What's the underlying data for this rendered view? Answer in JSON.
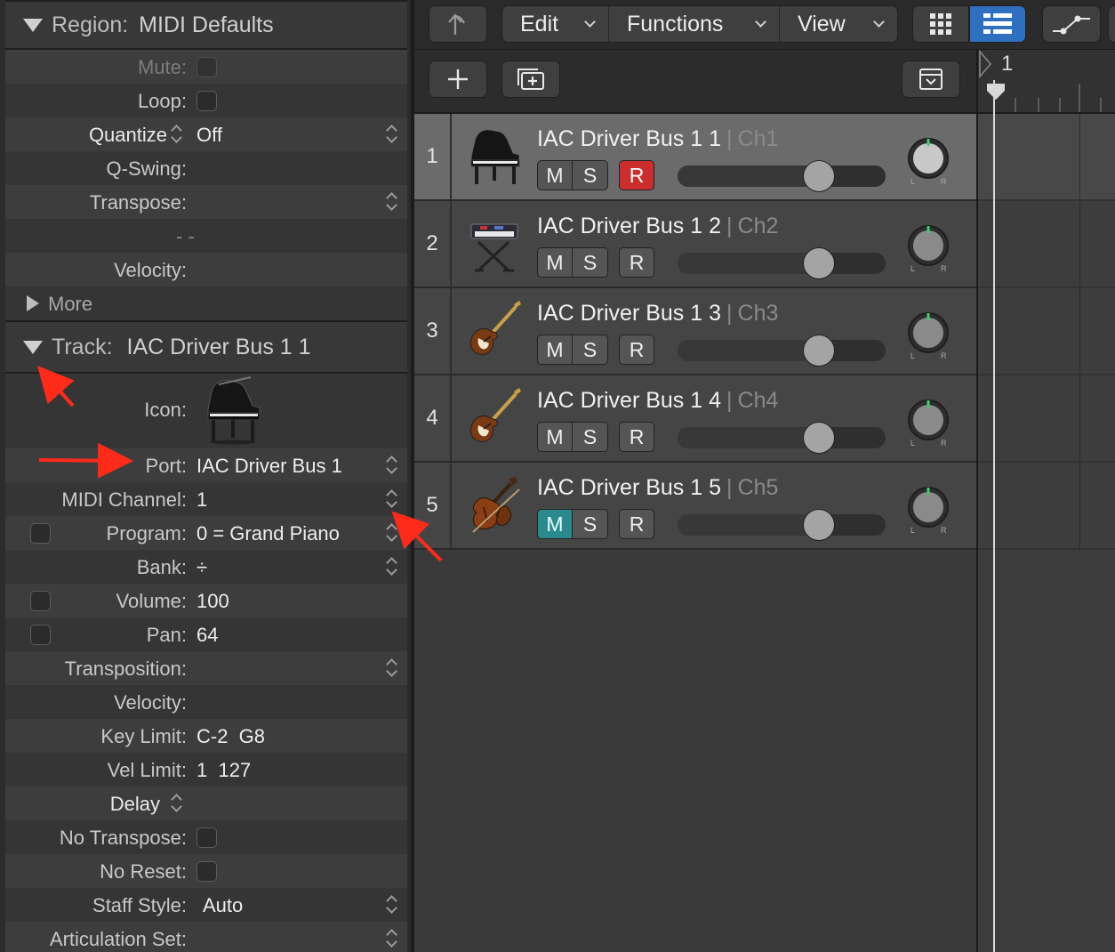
{
  "region": {
    "label": "Region:",
    "value": "MIDI Defaults",
    "rows": [
      {
        "key": "Mute:",
        "type": "checkbox"
      },
      {
        "key": "Loop:",
        "type": "checkbox"
      },
      {
        "key": "Quantize",
        "value": "Off"
      },
      {
        "key": "Q-Swing:",
        "value": ""
      },
      {
        "key": "Transpose:",
        "value": ""
      },
      {
        "key": "",
        "value": "- -"
      },
      {
        "key": "Velocity:",
        "value": ""
      }
    ],
    "more": "More"
  },
  "track_inspector": {
    "label": "Track:",
    "value": "IAC Driver Bus 1 1",
    "icon_label": "Icon:",
    "icon": "grand-piano-icon",
    "rows": [
      {
        "key": "Port:",
        "value": "IAC Driver Bus 1"
      },
      {
        "key": "MIDI Channel:",
        "value": "1"
      },
      {
        "key": "Program:",
        "value": "0 = Grand Piano"
      },
      {
        "key": "Bank:",
        "value": "÷"
      },
      {
        "key": "Volume:",
        "value": "100"
      },
      {
        "key": "Pan:",
        "value": "64"
      },
      {
        "key": "Transposition:",
        "value": ""
      },
      {
        "key": "Velocity:",
        "value": ""
      },
      {
        "key": "Key Limit:",
        "value": "C-2  G8"
      },
      {
        "key": "Vel Limit:",
        "value": "1  127"
      },
      {
        "key": "Delay",
        "value": ""
      },
      {
        "key": "No Transpose:",
        "value": ""
      },
      {
        "key": "No Reset:",
        "value": ""
      },
      {
        "key": "Staff Style:",
        "value": "Auto"
      },
      {
        "key": "Articulation Set:",
        "value": ""
      }
    ]
  },
  "toolbar": {
    "back_icon": "back-arrow-icon",
    "menus": [
      "Edit",
      "Functions",
      "View"
    ],
    "grid_view_icon": "grid-view-icon",
    "list_view_icon": "list-view-icon",
    "automation_icon": "automation-curve-icon"
  },
  "subbar": {
    "add_icon": "plus-icon",
    "duplicate_icon": "duplicate-track-icon",
    "collapse_icon": "collapse-icon"
  },
  "ruler": {
    "bar": "1"
  },
  "tracks": [
    {
      "num": "1",
      "name": "IAC Driver Bus 1 1",
      "sep": "|",
      "ch": "Ch1",
      "m": "M",
      "s": "S",
      "r": "R",
      "icon": "grand-piano-icon",
      "volume": 0.68,
      "selected": true,
      "mute_on": false,
      "rec_on": true
    },
    {
      "num": "2",
      "name": "IAC Driver Bus 1 2",
      "sep": "|",
      "ch": "Ch2",
      "m": "M",
      "s": "S",
      "r": "R",
      "icon": "keyboard-stand-icon",
      "volume": 0.68,
      "selected": false,
      "mute_on": false,
      "rec_on": false
    },
    {
      "num": "3",
      "name": "IAC Driver Bus 1 3",
      "sep": "|",
      "ch": "Ch3",
      "m": "M",
      "s": "S",
      "r": "R",
      "icon": "electric-guitar-icon",
      "volume": 0.68,
      "selected": false,
      "mute_on": false,
      "rec_on": false
    },
    {
      "num": "4",
      "name": "IAC Driver Bus 1 4",
      "sep": "|",
      "ch": "Ch4",
      "m": "M",
      "s": "S",
      "r": "R",
      "icon": "electric-guitar-icon",
      "volume": 0.68,
      "selected": false,
      "mute_on": false,
      "rec_on": false
    },
    {
      "num": "5",
      "name": "IAC Driver Bus 1 5",
      "sep": "|",
      "ch": "Ch5",
      "m": "M",
      "s": "S",
      "r": "R",
      "icon": "violin-icon",
      "volume": 0.68,
      "selected": false,
      "mute_on": true,
      "rec_on": false
    }
  ],
  "pan_labels": {
    "l": "L",
    "r": "R"
  },
  "colors": {
    "record": "#cc2e2e",
    "mute_active": "#2a8a8e",
    "list_view_active": "#2f6fbf",
    "annotation_arrow": "#ff2a1a"
  }
}
